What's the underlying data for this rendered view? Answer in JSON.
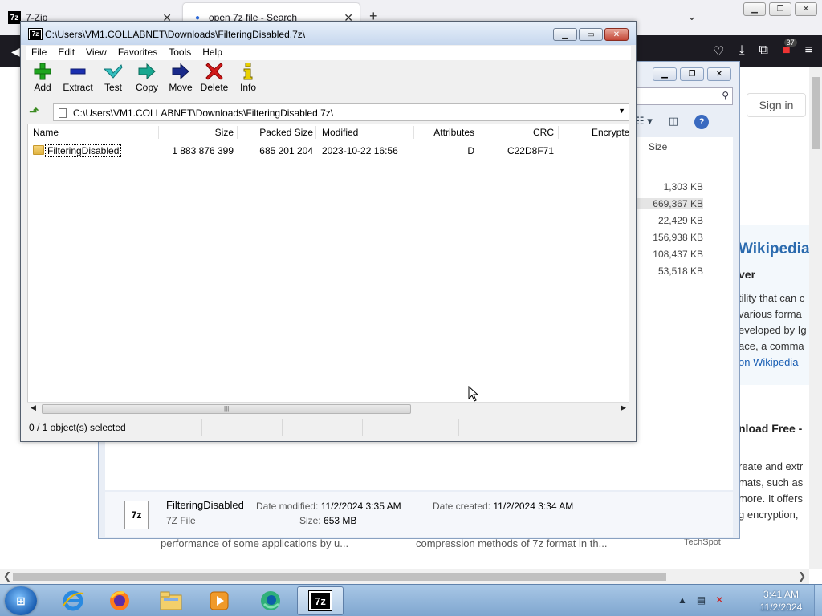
{
  "browser": {
    "tabs": [
      {
        "label": "7-Zip",
        "icon": "7zip-icon"
      },
      {
        "label": "open 7z file - Search",
        "icon": "search-icon"
      }
    ],
    "toolbar_badge": "37",
    "sign_in": "Sign in"
  },
  "background_page": {
    "wiki_title": "Wikipedia",
    "wiki_subtitle": "ver",
    "wiki_lines": [
      "tility that can c",
      "various forma",
      "eveloped by Ig",
      "ace, a comma"
    ],
    "wiki_link": "on Wikipedia",
    "download_title": "nload Free -",
    "download_lines": [
      "reate and extr",
      "mats, such as",
      "more. It offers",
      "g encryption, "
    ],
    "snippet_left": "performance of some applications by u...",
    "snippet_right": "compression methods of 7z format in th...",
    "techspot": "TechSpot"
  },
  "explorer": {
    "size_header": "Size",
    "sizes": [
      "1,303 KB",
      "669,367 KB",
      "22,429 KB",
      "156,938 KB",
      "108,437 KB",
      "53,518 KB"
    ],
    "selected_index": 1,
    "details": {
      "file_name": "FilteringDisabled",
      "file_type": "7Z File",
      "date_modified_label": "Date modified:",
      "date_modified": "11/2/2024 3:35 AM",
      "size_label": "Size:",
      "size": "653 MB",
      "date_created_label": "Date created:",
      "date_created": "11/2/2024 3:34 AM",
      "icon_text": "7z"
    }
  },
  "zip": {
    "title": "C:\\Users\\VM1.COLLABNET\\Downloads\\FilteringDisabled.7z\\",
    "app_icon_text": "7z",
    "menu": [
      "File",
      "Edit",
      "View",
      "Favorites",
      "Tools",
      "Help"
    ],
    "toolbar": [
      {
        "label": "Add",
        "icon": "plus-icon",
        "color": "#1fa61f"
      },
      {
        "label": "Extract",
        "icon": "minus-icon",
        "color": "#1a2fb0"
      },
      {
        "label": "Test",
        "icon": "check-icon",
        "color": "#1fa6a6"
      },
      {
        "label": "Copy",
        "icon": "arrow-right-teal-icon",
        "color": "#18988a"
      },
      {
        "label": "Move",
        "icon": "arrow-right-blue-icon",
        "color": "#1a2a8a"
      },
      {
        "label": "Delete",
        "icon": "x-icon",
        "color": "#d11a1a"
      },
      {
        "label": "Info",
        "icon": "info-icon",
        "color": "#b8a000"
      }
    ],
    "address": "C:\\Users\\VM1.COLLABNET\\Downloads\\FilteringDisabled.7z\\",
    "columns": [
      "Name",
      "Size",
      "Packed Size",
      "Modified",
      "Attributes",
      "CRC",
      "Encrypte"
    ],
    "rows": [
      {
        "name": "FilteringDisabled",
        "size": "1 883 876 399",
        "packed": "685 201 204",
        "modified": "2023-10-22 16:56",
        "attributes": "D",
        "crc": "C22D8F71",
        "encrypted": ""
      }
    ],
    "status": "0 / 1 object(s) selected",
    "colors": {
      "title_gradient_top": "#e8f0fa",
      "close_button": "#c24434"
    }
  },
  "taskbar": {
    "apps": [
      "internet-explorer-icon",
      "firefox-icon",
      "file-explorer-icon",
      "media-player-icon",
      "edge-icon",
      "7zip-icon"
    ],
    "active_app": "7zip-icon",
    "time": "3:41 AM",
    "date": "11/2/2024"
  }
}
